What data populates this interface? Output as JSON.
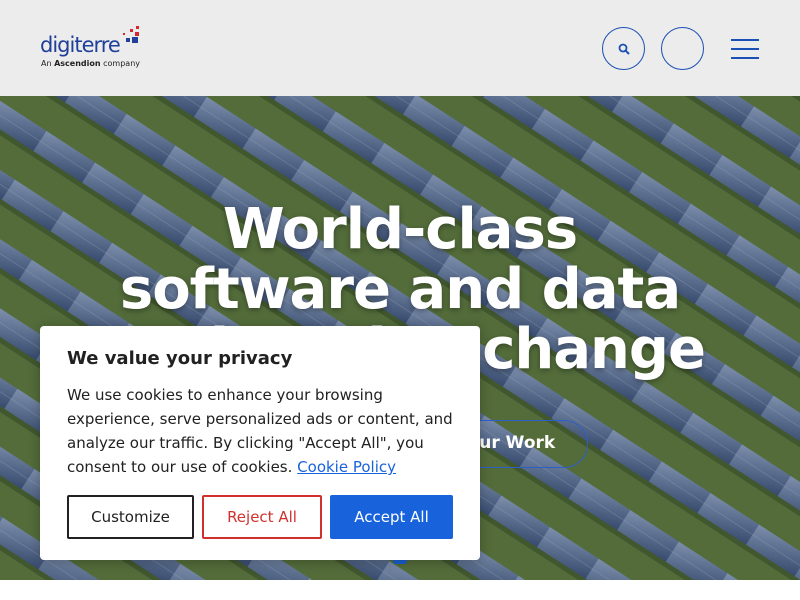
{
  "header": {
    "logo": {
      "word_part1": "digi",
      "word_part2": "terre",
      "subtitle_pre": "An ",
      "subtitle_brand": "Ascendion",
      "subtitle_post": " company",
      "colors": {
        "primary": "#1f3f9a",
        "accent_red": "#d8262f"
      }
    },
    "icons": [
      "search-icon",
      "globe-icon",
      "hamburger-menu-icon"
    ],
    "accent_color": "#1a4fb6"
  },
  "hero": {
    "title": "World-class software and data engineering change",
    "cta_label": "Our Work",
    "image": "aerial solar panel field on green grass"
  },
  "cookie_banner": {
    "title": "We value your privacy",
    "body": "We use cookies to enhance your browsing experience, serve personalized ads or content, and analyze our traffic. By clicking \"Accept All\", you consent to our use of cookies.",
    "link_label": "Cookie Policy",
    "buttons": {
      "customize": "Customize",
      "reject": "Reject All",
      "accept": "Accept All"
    },
    "colors": {
      "accept_bg": "#1863dc",
      "reject": "#d0312d",
      "link": "#1863dc"
    }
  }
}
